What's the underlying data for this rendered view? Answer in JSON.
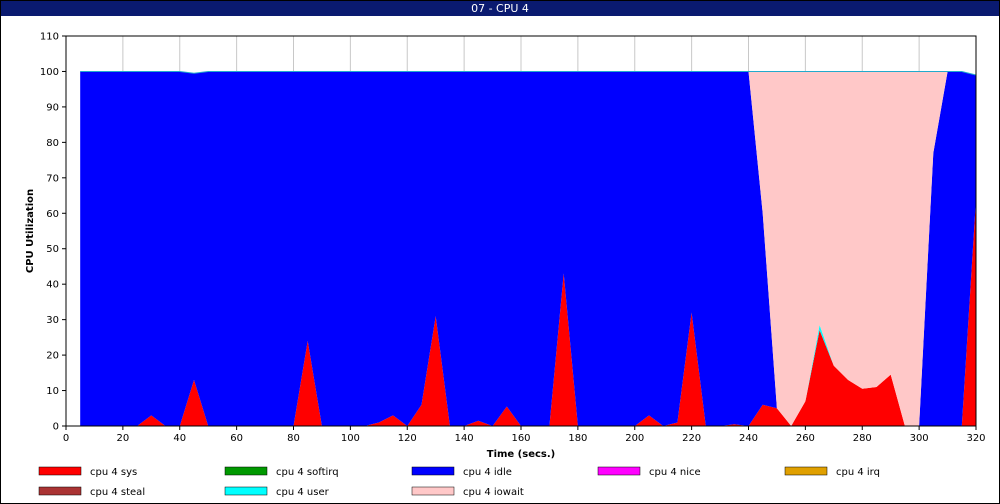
{
  "window": {
    "title": "07 - CPU 4"
  },
  "chart_data": {
    "type": "area",
    "title": "07 - CPU 4",
    "xlabel": "Time (secs.)",
    "ylabel": "CPU Utilization",
    "xlim": [
      0,
      320
    ],
    "ylim": [
      0,
      110
    ],
    "xticks": [
      0,
      20,
      40,
      60,
      80,
      100,
      120,
      140,
      160,
      180,
      200,
      220,
      240,
      260,
      280,
      300,
      320
    ],
    "yticks": [
      0,
      10,
      20,
      30,
      40,
      50,
      60,
      70,
      80,
      90,
      100,
      110
    ],
    "grid": "vertical",
    "legend_position": "bottom",
    "x": [
      5,
      10,
      15,
      20,
      25,
      30,
      35,
      40,
      45,
      50,
      55,
      60,
      65,
      70,
      75,
      80,
      85,
      90,
      95,
      100,
      105,
      110,
      115,
      120,
      125,
      130,
      135,
      140,
      145,
      150,
      155,
      160,
      165,
      170,
      175,
      180,
      185,
      190,
      195,
      200,
      205,
      210,
      215,
      220,
      225,
      230,
      235,
      240,
      245,
      250,
      255,
      260,
      265,
      270,
      275,
      280,
      285,
      290,
      295,
      300,
      305,
      310,
      315,
      320
    ],
    "series": [
      {
        "name": "cpu 4 sys",
        "color": "#ff0000",
        "values": [
          0,
          0,
          0,
          0,
          0,
          3,
          0,
          0,
          13,
          0,
          0,
          0,
          0,
          0,
          0,
          0,
          24,
          0,
          0,
          0,
          0,
          1,
          3,
          0,
          6,
          31,
          0,
          0,
          1.5,
          0,
          5.5,
          0,
          0,
          0,
          43,
          0,
          0,
          0,
          0,
          0,
          3,
          0,
          1,
          32,
          0,
          0,
          0.5,
          0,
          6,
          5,
          0,
          7,
          27,
          17,
          13,
          10.5,
          11,
          14.5,
          0,
          0,
          0,
          0,
          0,
          64
        ]
      },
      {
        "name": "cpu 4 softirq",
        "color": "#009900",
        "values": [
          0,
          0,
          0,
          0,
          0,
          0,
          0,
          0,
          0,
          0,
          0,
          0,
          0,
          0,
          0,
          0,
          0,
          0,
          0,
          0,
          0,
          0,
          0,
          0,
          0,
          0,
          0,
          0,
          0,
          0,
          0,
          0,
          0,
          0,
          0,
          0,
          0,
          0,
          0,
          0,
          0,
          0,
          0,
          0,
          0,
          0,
          0,
          0,
          0,
          0,
          0,
          0,
          0,
          0,
          0,
          0,
          0,
          0,
          0,
          0,
          0,
          0,
          0,
          0
        ]
      },
      {
        "name": "cpu 4 idle",
        "color": "#0000ff",
        "values": [
          100,
          100,
          100,
          100,
          100,
          97,
          100,
          100,
          86.5,
          100,
          100,
          100,
          100,
          100,
          100,
          100,
          76,
          100,
          100,
          100,
          100,
          99,
          97,
          100,
          94,
          69,
          100,
          100,
          98.5,
          100,
          94.5,
          100,
          100,
          100,
          57,
          100,
          100,
          100,
          100,
          100,
          97,
          100,
          99,
          68,
          100,
          100,
          99.5,
          100,
          54,
          0,
          0,
          0,
          0,
          0,
          0,
          0,
          0,
          0,
          0,
          0,
          77,
          100,
          100,
          35
        ]
      },
      {
        "name": "cpu 4 nice",
        "color": "#ff00ff",
        "values": [
          0,
          0,
          0,
          0,
          0,
          0,
          0,
          0,
          0,
          0,
          0,
          0,
          0,
          0,
          0,
          0,
          0,
          0,
          0,
          0,
          0,
          0,
          0,
          0,
          0,
          0,
          0,
          0,
          0,
          0,
          0,
          0,
          0,
          0,
          0,
          0,
          0,
          0,
          0,
          0,
          0,
          0,
          0,
          0,
          0,
          0,
          0,
          0,
          0,
          0,
          0,
          0,
          0,
          0,
          0,
          0,
          0,
          0,
          0,
          0,
          0,
          0,
          0,
          0
        ]
      },
      {
        "name": "cpu 4 irq",
        "color": "#e0a000",
        "values": [
          0,
          0,
          0,
          0,
          0,
          0,
          0,
          0,
          0,
          0,
          0,
          0,
          0,
          0,
          0,
          0,
          0,
          0,
          0,
          0,
          0,
          0,
          0,
          0,
          0,
          0,
          0,
          0,
          0,
          0,
          0,
          0,
          0,
          0,
          0,
          0,
          0,
          0,
          0,
          0,
          0,
          0,
          0,
          0,
          0,
          0,
          0,
          0,
          0,
          0,
          0,
          0,
          0,
          0,
          0,
          0,
          0,
          0,
          0,
          0,
          0,
          0,
          0,
          0
        ]
      },
      {
        "name": "cpu 4 steal",
        "color": "#aa3333",
        "values": [
          0,
          0,
          0,
          0,
          0,
          0,
          0,
          0,
          0,
          0,
          0,
          0,
          0,
          0,
          0,
          0,
          0,
          0,
          0,
          0,
          0,
          0,
          0,
          0,
          0,
          0,
          0,
          0,
          0,
          0,
          0,
          0,
          0,
          0,
          0,
          0,
          0,
          0,
          0,
          0,
          0,
          0,
          0,
          0,
          0,
          0,
          0,
          0,
          0,
          0,
          0,
          0,
          0,
          0,
          0,
          0,
          0,
          0,
          0,
          0,
          0,
          0,
          0,
          0
        ]
      },
      {
        "name": "cpu 4 user",
        "color": "#00ffff",
        "values": [
          0,
          0,
          0,
          0,
          0,
          0,
          0,
          0,
          0,
          0,
          0,
          0,
          0,
          0,
          0,
          0,
          0,
          0,
          0,
          0,
          0,
          0,
          0,
          0,
          0,
          0,
          0,
          0,
          0,
          0,
          0,
          0,
          0,
          0,
          0,
          0,
          0,
          0,
          0,
          0,
          0,
          0,
          0,
          0,
          0,
          0,
          0,
          0,
          0,
          0,
          0,
          0,
          1.5,
          0,
          0,
          0,
          0,
          0,
          0,
          0,
          0,
          0,
          0,
          0
        ]
      },
      {
        "name": "cpu 4 iowait",
        "color": "#ffc8c8",
        "values": [
          0,
          0,
          0,
          0,
          0,
          0,
          0,
          0,
          0,
          0,
          0,
          0,
          0,
          0,
          0,
          0,
          0,
          0,
          0,
          0,
          0,
          0,
          0,
          0,
          0,
          0,
          0,
          0,
          0,
          0,
          0,
          0,
          0,
          0,
          0,
          0,
          0,
          0,
          0,
          0,
          0,
          0,
          0,
          0,
          0,
          0,
          0,
          0,
          40,
          95,
          100,
          93,
          71.5,
          83,
          87,
          89.5,
          89,
          85.5,
          100,
          100,
          23,
          0,
          0,
          0
        ]
      }
    ]
  }
}
